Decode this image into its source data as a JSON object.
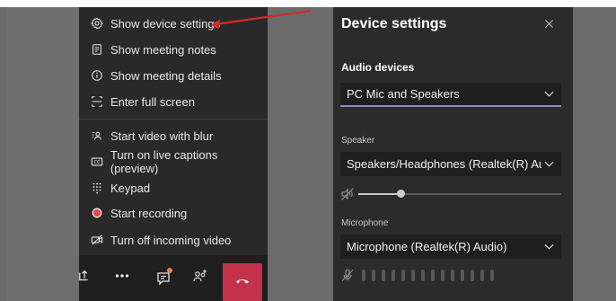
{
  "menu": {
    "items": [
      {
        "label": "Show device settings",
        "icon": "gear-icon"
      },
      {
        "label": "Show meeting notes",
        "icon": "notes-icon"
      },
      {
        "label": "Show meeting details",
        "icon": "info-icon"
      },
      {
        "label": "Enter full screen",
        "icon": "fullscreen-icon"
      },
      {
        "label": "Start video with blur",
        "icon": "blur-icon"
      },
      {
        "label": "Turn on live captions (preview)",
        "icon": "captions-icon"
      },
      {
        "label": "Keypad",
        "icon": "keypad-icon"
      },
      {
        "label": "Start recording",
        "icon": "record-icon"
      },
      {
        "label": "Turn off incoming video",
        "icon": "video-off-icon"
      }
    ]
  },
  "toolbar": {
    "items": [
      "share-icon",
      "more-icon",
      "chat-icon",
      "participants-icon",
      "hangup-icon"
    ]
  },
  "panel": {
    "title": "Device settings",
    "audio_devices_label": "Audio devices",
    "audio_device_value": "PC Mic and Speakers",
    "speaker_label": "Speaker",
    "speaker_value": "Speakers/Headphones (Realtek(R) Au...",
    "speaker_volume": 0.21,
    "microphone_label": "Microphone",
    "microphone_value": "Microphone (Realtek(R) Audio)",
    "mic_level_bars": 14
  },
  "colors": {
    "accent": "#8b8cc7",
    "hangup": "#c4314b",
    "record": "#e8474c",
    "notification_dot": "#f47c3c",
    "annotation_arrow": "#d12b2b"
  }
}
